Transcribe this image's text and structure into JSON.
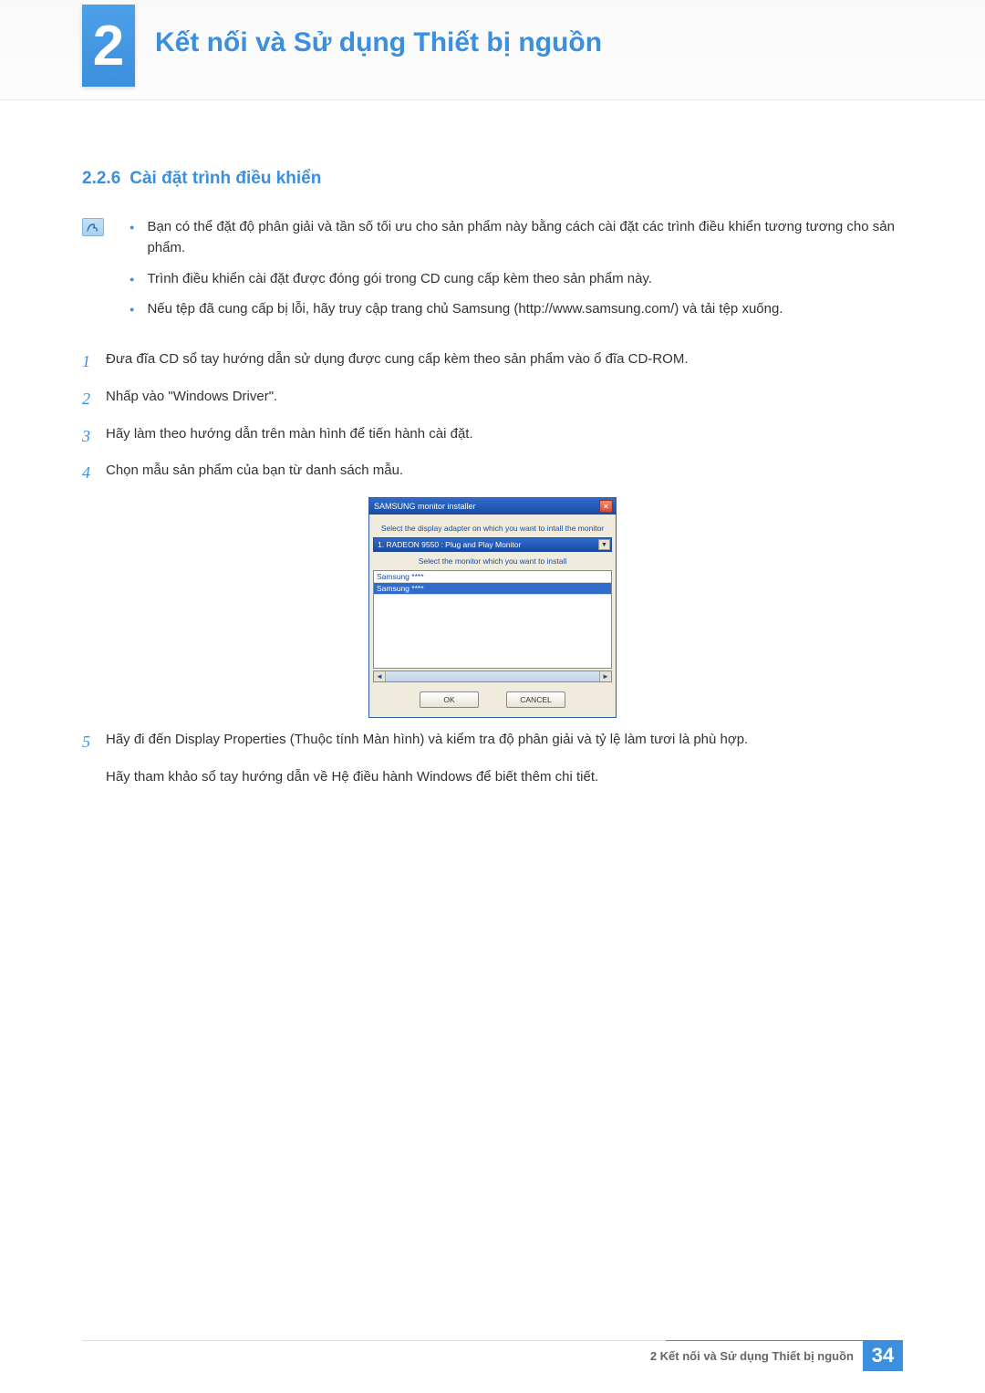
{
  "chapter": {
    "number": "2",
    "title": "Kết nối và Sử dụng Thiết bị nguồn"
  },
  "section": {
    "number": "2.2.6",
    "title": "Cài đặt trình điều khiển"
  },
  "note_bullets": [
    "Bạn có thể đặt độ phân giải và tần số tối ưu cho sản phẩm này bằng cách cài đặt các trình điều khiển tương tương cho sản phẩm.",
    "Trình điều khiển cài đặt được đóng gói trong CD cung cấp kèm theo sản phẩm này.",
    "Nếu tệp đã cung cấp bị lỗi, hãy truy cập trang chủ Samsung (http://www.samsung.com/) và tải tệp xuống."
  ],
  "steps": [
    {
      "num": "1",
      "text": "Đưa đĩa CD sổ tay hướng dẫn sử dụng được cung cấp kèm theo sản phẩm vào ổ đĩa CD-ROM."
    },
    {
      "num": "2",
      "text": "Nhấp vào \"Windows Driver\"."
    },
    {
      "num": "3",
      "text": "Hãy làm theo hướng dẫn trên màn hình để tiến hành cài đặt."
    },
    {
      "num": "4",
      "text": "Chọn mẫu sản phẩm của bạn từ danh sách mẫu."
    }
  ],
  "installer": {
    "title": "SAMSUNG monitor installer",
    "close": "×",
    "label1": "Select the display adapter on which you want to intall the monitor",
    "select_value": "1. RADEON 9550 : Plug and Play Monitor",
    "label2": "Select the monitor which you want to install",
    "list_items": [
      "Samsung ****",
      "Samsung ****"
    ],
    "ok": "OK",
    "cancel": "CANCEL"
  },
  "step5": {
    "num": "5",
    "text": "Hãy đi đến Display Properties (Thuộc tính Màn hình) và kiểm tra độ phân giải và tỷ lệ làm tươi là phù hợp."
  },
  "reference_text": "Hãy tham khảo sổ tay hướng dẫn về Hệ điều hành Windows để biết thêm chi tiết.",
  "footer": {
    "caption": "2 Kết nối và Sử dụng Thiết bị nguồn",
    "page": "34"
  }
}
